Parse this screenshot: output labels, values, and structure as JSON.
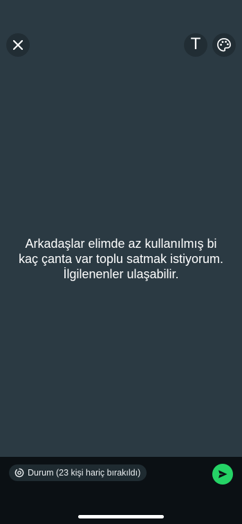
{
  "app": {
    "background_color": "#2b3a43",
    "accent_color": "#25d366"
  },
  "toolbar": {
    "close_icon": "close-icon",
    "text_tool_label": "T",
    "palette_icon": "palette-icon"
  },
  "status": {
    "text": "Arkadaşlar elimde az kullanılmış bi kaç çanta var toplu satmak istiyorum. İlgilenenler ulaşabilir."
  },
  "footer": {
    "audience_icon": "status-ring-icon",
    "audience_label": "Durum (23 kişi hariç bırakıldı)",
    "send_icon": "send-icon"
  }
}
